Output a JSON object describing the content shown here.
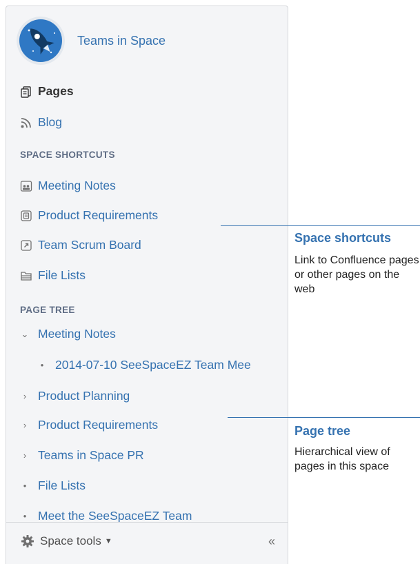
{
  "header": {
    "space_name": "Teams in Space"
  },
  "nav": {
    "pages_label": "Pages",
    "blog_label": "Blog"
  },
  "space_shortcuts": {
    "heading": "SPACE SHORTCUTS",
    "items": [
      {
        "label": "Meeting Notes",
        "icon": "meeting-notes-icon"
      },
      {
        "label": "Product Requirements",
        "icon": "requirements-icon"
      },
      {
        "label": "Team Scrum Board",
        "icon": "external-link-icon"
      },
      {
        "label": "File Lists",
        "icon": "file-list-icon"
      }
    ]
  },
  "page_tree": {
    "heading": "PAGE TREE",
    "items": [
      {
        "label": "Meeting Notes",
        "state": "expanded"
      },
      {
        "label": "2014-07-10 SeeSpaceEZ Team Mee",
        "state": "leaf",
        "child": true
      },
      {
        "label": "Product Planning",
        "state": "collapsed"
      },
      {
        "label": "Product Requirements",
        "state": "collapsed"
      },
      {
        "label": "Teams in Space PR",
        "state": "collapsed"
      },
      {
        "label": "File Lists",
        "state": "leaf"
      },
      {
        "label": "Meet the SeeSpaceEZ Team",
        "state": "leaf"
      }
    ]
  },
  "footer": {
    "space_tools_label": "Space tools",
    "collapse_glyph": "«"
  },
  "callouts": {
    "shortcuts": {
      "title": "Space shortcuts",
      "text": "Link to Confluence pages or other pages on the web"
    },
    "tree": {
      "title": "Page tree",
      "text": "Hierarchical view of pages in this space"
    }
  },
  "colors": {
    "link": "#3572b0",
    "sidebar_bg": "#f4f5f7",
    "border": "#d6d8dc",
    "heading": "#5e6c84"
  }
}
